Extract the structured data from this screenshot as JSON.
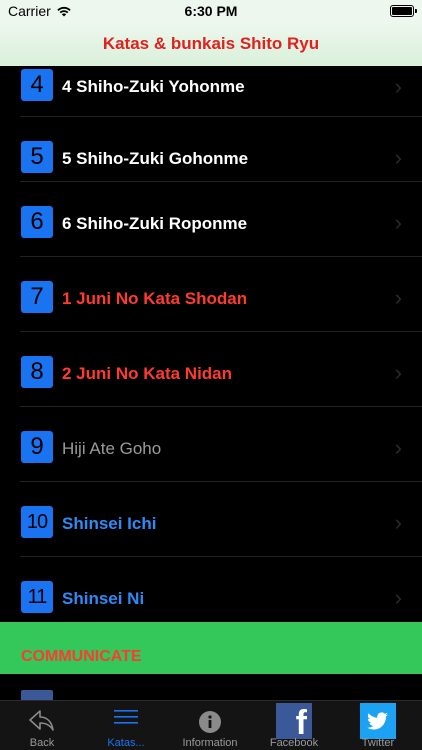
{
  "status_bar": {
    "carrier": "Carrier",
    "time": "6:30 PM"
  },
  "nav": {
    "title": "Katas & bunkais Shito Ryu"
  },
  "list": {
    "items": [
      {
        "number": "4",
        "label": "4 Shiho-Zuki Yohonme",
        "color": "white"
      },
      {
        "number": "5",
        "label": "5 Shiho-Zuki Gohonme",
        "color": "white"
      },
      {
        "number": "6",
        "label": "6 Shiho-Zuki Roponme",
        "color": "white"
      },
      {
        "number": "7",
        "label": "1 Juni No Kata Shodan",
        "color": "red"
      },
      {
        "number": "8",
        "label": "2 Juni No Kata Nidan",
        "color": "red"
      },
      {
        "number": "9",
        "label": "Hiji Ate Goho",
        "color": "gray"
      },
      {
        "number": "10",
        "label": "Shinsei Ichi",
        "color": "blue"
      },
      {
        "number": "11",
        "label": "Shinsei Ni",
        "color": "blue"
      }
    ]
  },
  "section": {
    "communicate_label": "COMMUNICATE"
  },
  "tabs": [
    {
      "label": "Back",
      "icon": "back-icon",
      "active": false
    },
    {
      "label": "Katas...",
      "icon": "list-icon",
      "active": true
    },
    {
      "label": "Information",
      "icon": "info-icon",
      "active": false
    },
    {
      "label": "Facebook",
      "icon": "facebook-icon",
      "active": false
    },
    {
      "label": "Twitter",
      "icon": "twitter-icon",
      "active": false
    }
  ],
  "colors": {
    "accent": "#1a73f0",
    "title_red": "#e0211d",
    "communicate_bg": "#34c759"
  }
}
